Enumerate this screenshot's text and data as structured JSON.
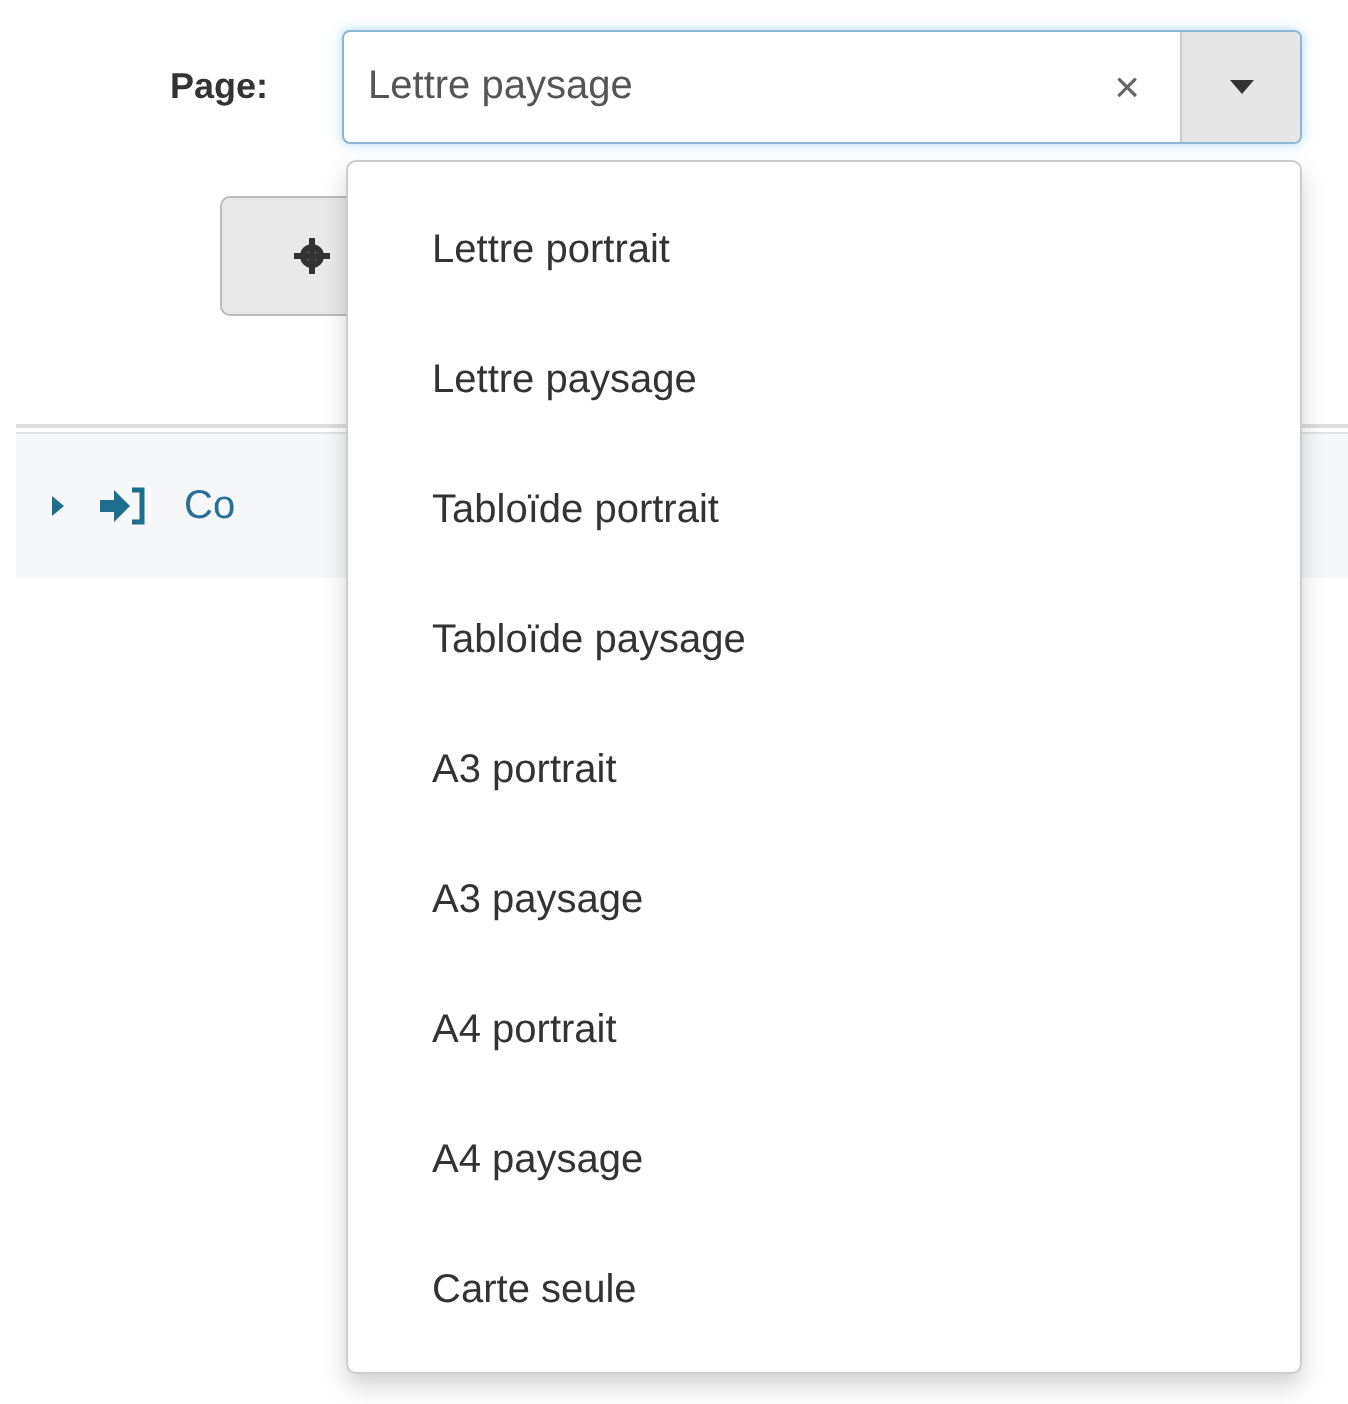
{
  "page_field": {
    "label": "Page:",
    "value": "Lettre paysage",
    "clear": "×"
  },
  "dropdown": {
    "open": true,
    "options": [
      {
        "label": "Lettre portrait"
      },
      {
        "label": "Lettre paysage"
      },
      {
        "label": "Tabloïde portrait"
      },
      {
        "label": "Tabloïde paysage"
      },
      {
        "label": "A3 portrait"
      },
      {
        "label": "A3 paysage"
      },
      {
        "label": "A4 portrait"
      },
      {
        "label": "A4 paysage"
      },
      {
        "label": "Carte seule"
      }
    ]
  },
  "panel": {
    "link": "Co"
  }
}
